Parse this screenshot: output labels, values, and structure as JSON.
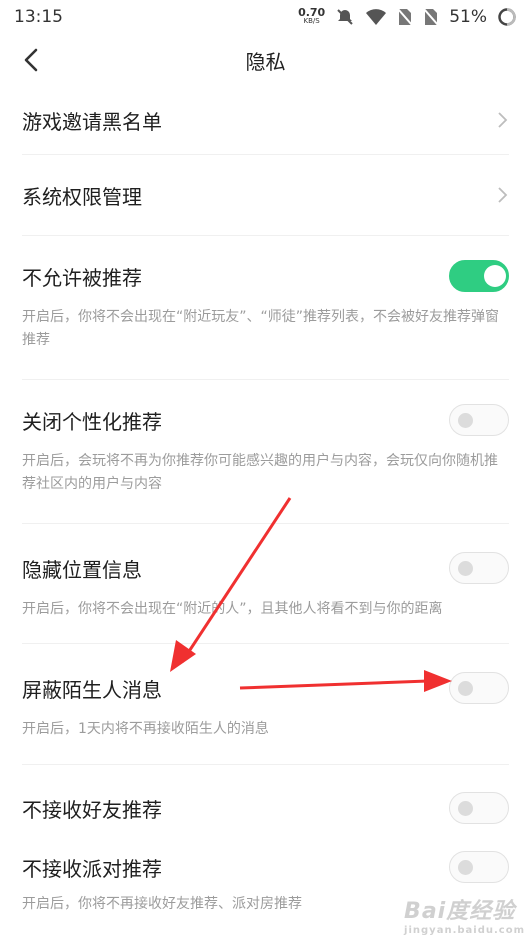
{
  "status_bar": {
    "time": "13:15",
    "net_speed": "0.70",
    "net_unit": "KB/S",
    "battery": "51%"
  },
  "header": {
    "title": "隐私"
  },
  "items": [
    {
      "label": "游戏邀请黑名单"
    },
    {
      "label": "系统权限管理"
    },
    {
      "label": "不允许被推荐",
      "enabled": true,
      "desc": "开启后，你将不会出现在“附近玩友”、“师徒”推荐列表，不会被好友推荐弹窗推荐"
    },
    {
      "label": "关闭个性化推荐",
      "enabled": false,
      "desc": "开启后，会玩将不再为你推荐你可能感兴趣的用户与内容，会玩仅向你随机推荐社区内的用户与内容"
    },
    {
      "label": "隐藏位置信息",
      "enabled": false,
      "desc": "开启后，你将不会出现在“附近的人”，且其他人将看不到与你的距离"
    },
    {
      "label": "屏蔽陌生人消息",
      "enabled": false,
      "desc": "开启后，1天内将不再接收陌生人的消息"
    },
    {
      "label": "不接收好友推荐",
      "enabled": false
    },
    {
      "label": "不接收派对推荐",
      "enabled": false,
      "desc": "开启后，你将不再接收好友推荐、派对房推荐"
    }
  ],
  "annotation": {
    "arrow_color": "#f03030"
  },
  "watermark": {
    "brand": "Bai度经验",
    "url": "jingyan.baidu.com"
  }
}
